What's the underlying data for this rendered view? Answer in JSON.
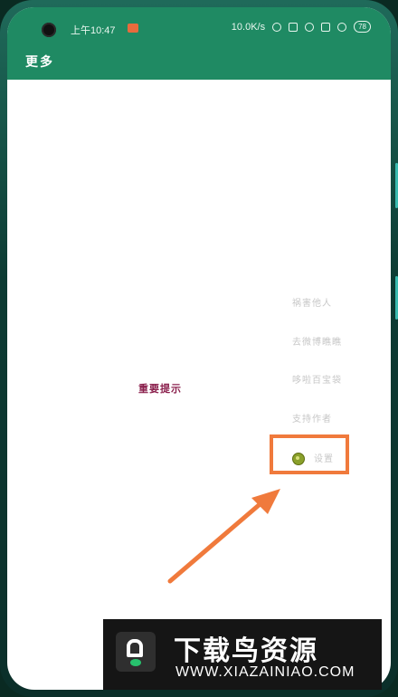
{
  "status_bar": {
    "time": "上午10:47",
    "speed": "10.0K/s",
    "battery": "78"
  },
  "header": {
    "title": "更多"
  },
  "main": {
    "notice_label": "重要提示"
  },
  "menu": {
    "items": [
      {
        "label": "祸害他人"
      },
      {
        "label": "去微博瞧瞧"
      },
      {
        "label": "哆啦百宝袋"
      },
      {
        "label": "支持作者"
      },
      {
        "label": "设置"
      }
    ]
  },
  "watermark": {
    "title": "下载鸟资源",
    "url": "WWW.XIAZAINIAO.COM"
  },
  "colors": {
    "header_bg": "#1f8a63",
    "highlight": "#f07a3c",
    "notice_text": "#8a1f4c"
  }
}
